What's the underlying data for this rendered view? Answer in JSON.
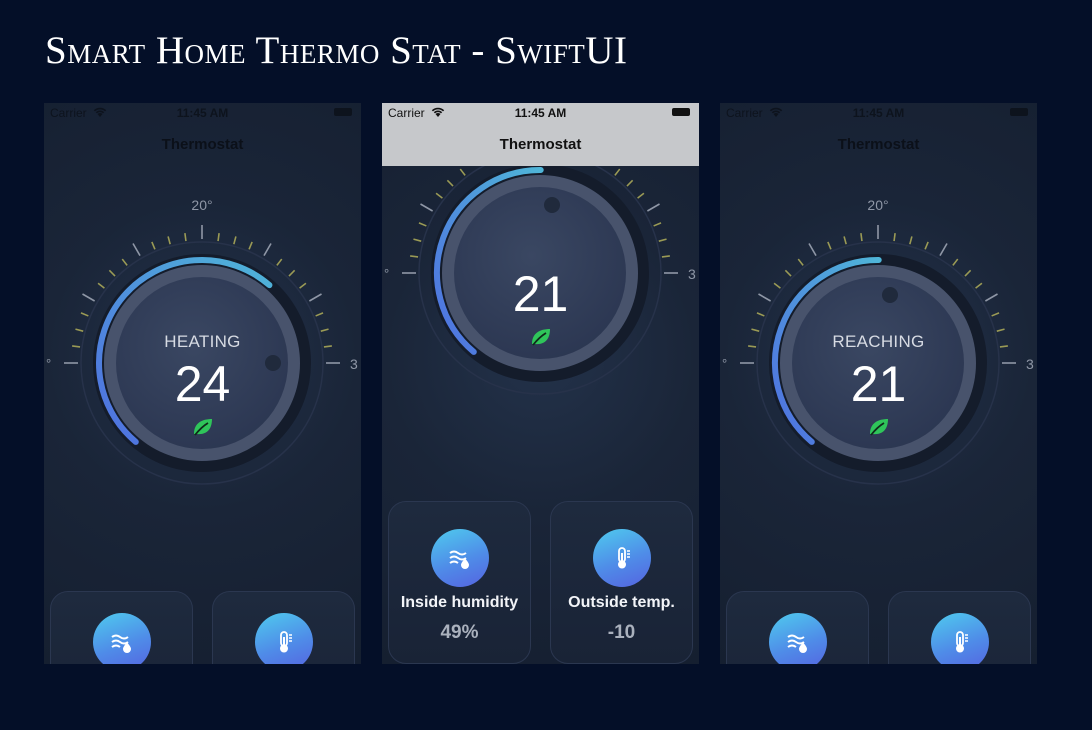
{
  "page": {
    "title": "Smart Home Thermo Stat - SwiftUI"
  },
  "status_bar": {
    "carrier": "Carrier",
    "time": "11:45 AM"
  },
  "screens": [
    {
      "nav_title": "Thermostat",
      "mode": "HEATING",
      "temperature": "24",
      "scale_top_label": "20°",
      "scale_left_label": "°",
      "scale_right_label": "3",
      "progress_fraction": 0.67
    },
    {
      "nav_title": "Thermostat",
      "mode": "",
      "temperature": "21",
      "scale_left_label": "°",
      "scale_right_label": "3",
      "progress_fraction": 0.52,
      "cards": [
        {
          "icon": "humidity-icon",
          "label": "Inside humidity",
          "value": "49%"
        },
        {
          "icon": "thermometer-icon",
          "label": "Outside temp.",
          "value": "-10"
        }
      ]
    },
    {
      "nav_title": "Thermostat",
      "mode": "REACHING",
      "temperature": "21",
      "scale_top_label": "20°",
      "scale_left_label": "°",
      "scale_right_label": "3",
      "progress_fraction": 0.52
    }
  ],
  "colors": {
    "background": "#040f28",
    "screen": "#1a2538",
    "accent_start": "#4f6fe0",
    "accent_end": "#4fb5d8",
    "tick": "#9a9a55",
    "eco_leaf": "#2fc55a"
  }
}
